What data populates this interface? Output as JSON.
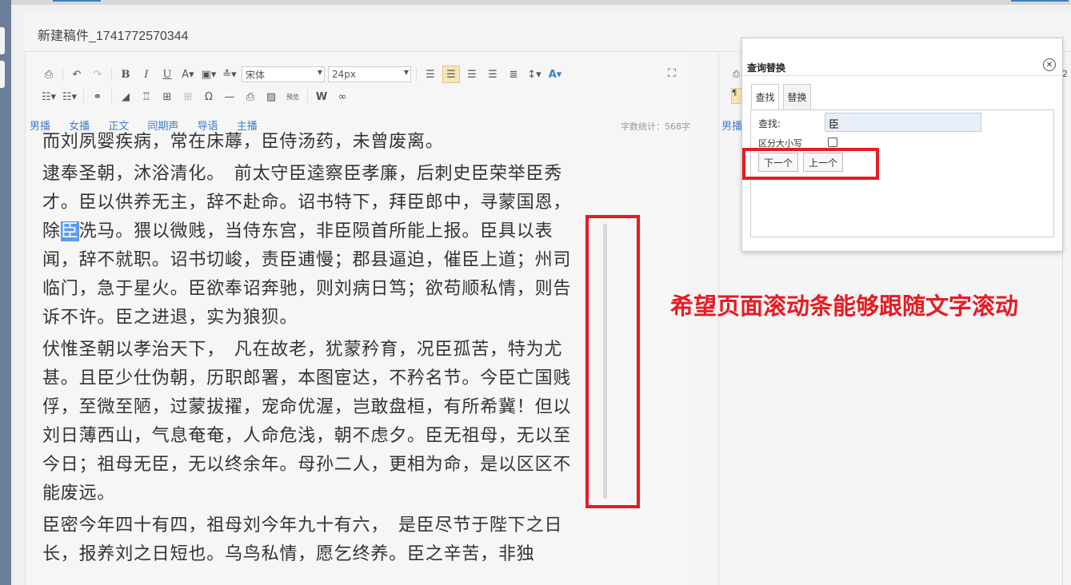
{
  "draft": {
    "title": "新建稿件_1741772570344"
  },
  "toolbar": {
    "font_family": "宋体",
    "font_size": "24px",
    "preview_label": "预览",
    "word_label": "W"
  },
  "role_tabs": [
    {
      "label": "男播"
    },
    {
      "label": "女播"
    },
    {
      "label": "正文"
    },
    {
      "label": "同期声"
    },
    {
      "label": "导语"
    },
    {
      "label": "主播"
    }
  ],
  "word_count": "字数统计：568字",
  "paragraphs": [
    {
      "text": "而刘夙婴疾病，常在床蓐，臣侍汤药，未曾废离。"
    },
    {
      "before": "逮奉圣朝，沐浴清化。　前太守臣逵察臣孝廉，后刺史臣荣举臣秀才。臣以供养无主，辞不赴命。诏书特下，拜臣郎中，寻蒙国恩，除",
      "highlight": "臣",
      "after": "洗马。猥以微贱，当侍东宫，非臣陨首所能上报。臣具以表闻，辞不就职。诏书切峻，责臣逋慢；郡县逼迫，催臣上道；州司临门，急于星火。臣欲奉诏奔驰，则刘病日笃；欲苟顺私情，则告诉不许。臣之进退，实为狼狈。"
    },
    {
      "text": "伏惟圣朝以孝治天下，　凡在故老，犹蒙矜育，况臣孤苦，特为尤甚。且臣少仕伪朝，历职郎署，本图宦达，不矜名节。今臣亡国贱俘，至微至陋，过蒙拔擢，宠命优渥，岂敢盘桓，有所希冀！但以刘日薄西山，气息奄奄，人命危浅，朝不虑夕。臣无祖母，无以至今日；祖母无臣，无以终余年。母孙二人，更相为命，是以区区不能废远。"
    },
    {
      "text": "臣密今年四十有四，祖母刘今年九十有六，　是臣尽节于陛下之日长，报养刘之日短也。乌鸟私情，愿乞终养。臣之辛苦，非独"
    }
  ],
  "right_panel": {
    "tab_label": "男播",
    "size_fragment": "2"
  },
  "dialog": {
    "title": "查询替换",
    "tab_find": "查找",
    "tab_replace": "替换",
    "find_label": "查找:",
    "find_value": "臣",
    "case_label": "区分大小写",
    "case_checked": false,
    "next_button": "下一个",
    "prev_button": "上一个"
  },
  "annotation": "希望页面滚动条能够跟随文字滚动",
  "colors": {
    "annotation": "#e51c23",
    "highlight": "#5b9bf0",
    "link": "#3d7fd0"
  },
  "icons": [
    "print-icon",
    "undo-icon",
    "redo-icon",
    "bold-icon",
    "italic-icon",
    "underline-icon",
    "font-color-icon",
    "background-color-icon",
    "line-height-icon",
    "align-left-icon",
    "align-center-icon",
    "align-right-icon",
    "justify-icon",
    "fullscreen-icon",
    "link-icon",
    "eraser-icon",
    "table-icon",
    "omega-icon",
    "image-icon",
    "binoculars-icon",
    "close-icon"
  ]
}
